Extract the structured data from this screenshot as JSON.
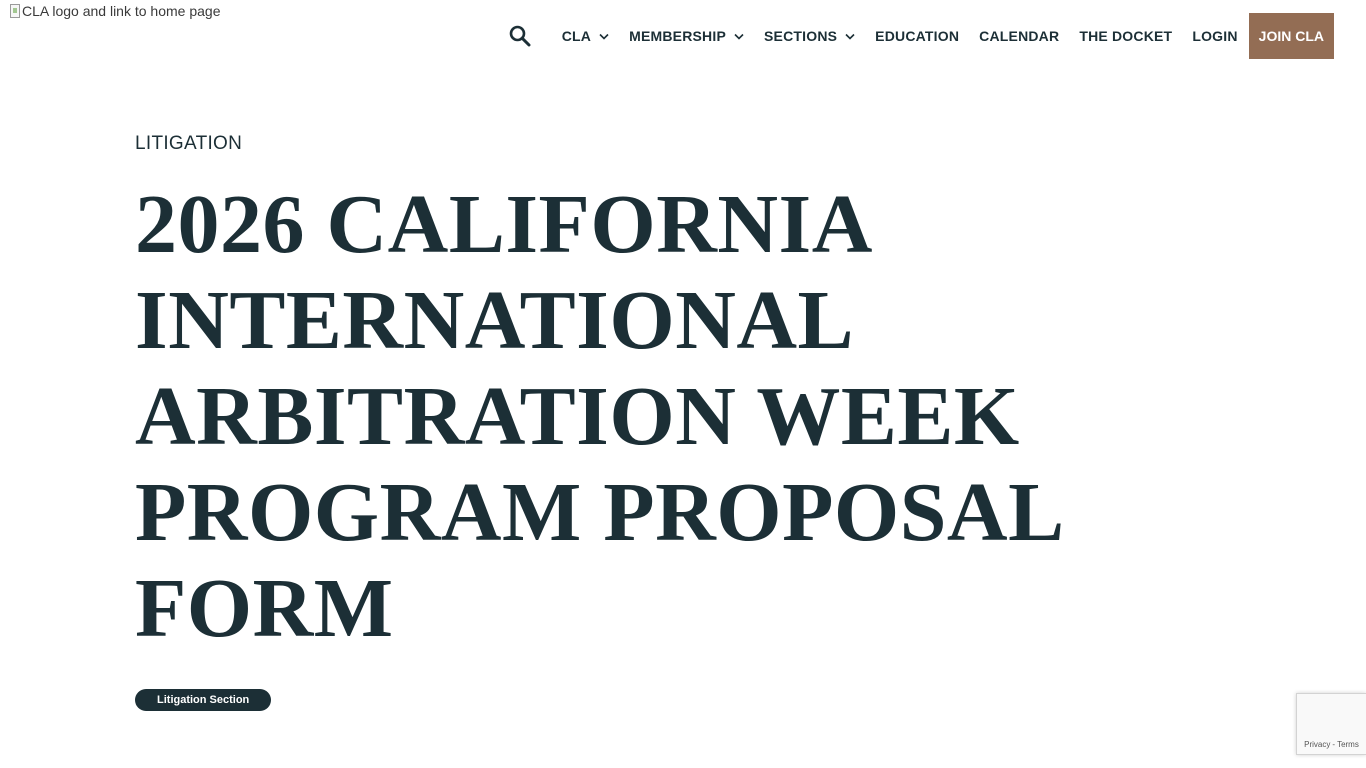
{
  "header": {
    "logo_alt": "CLA logo and link to home page",
    "nav": [
      {
        "label": "CLA",
        "has_dropdown": true
      },
      {
        "label": "MEMBERSHIP",
        "has_dropdown": true
      },
      {
        "label": "SECTIONS",
        "has_dropdown": true
      },
      {
        "label": "EDUCATION",
        "has_dropdown": false
      },
      {
        "label": "CALENDAR",
        "has_dropdown": false
      },
      {
        "label": "THE DOCKET",
        "has_dropdown": false
      },
      {
        "label": "LOGIN",
        "has_dropdown": false
      }
    ],
    "join_label": "JOIN CLA",
    "search_icon": "search-icon"
  },
  "main": {
    "eyebrow": "LITIGATION",
    "title": "2026 CALIFORNIA INTERNATIONAL ARBITRATION WEEK PROGRAM PROPOSAL FORM",
    "tag": "Litigation Section"
  },
  "recaptcha": {
    "privacy": "Privacy",
    "separator": "-",
    "terms": "Terms"
  },
  "colors": {
    "text": "#1c2f36",
    "accent": "#936d54",
    "tag_bg": "#1c2f36"
  }
}
